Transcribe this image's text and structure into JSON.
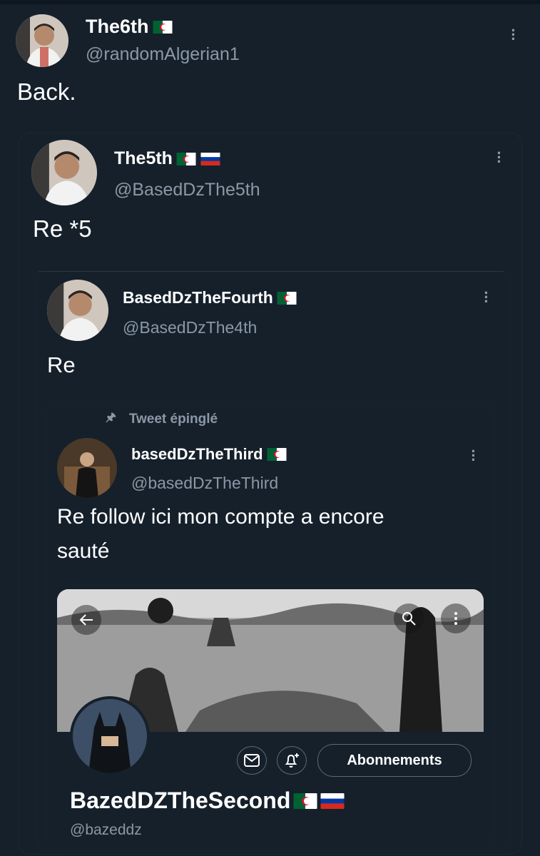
{
  "tweet1": {
    "name": "The6th",
    "handle": "@randomAlgerian1",
    "text": "Back.",
    "flags": [
      "algeria"
    ]
  },
  "tweet2": {
    "name": "The5th",
    "handle": "@BasedDzThe5th",
    "text": "Re *5",
    "flags": [
      "algeria",
      "russia"
    ]
  },
  "tweet3": {
    "name": "BasedDzTheFourth",
    "handle": "@BasedDzThe4th",
    "text": "Re",
    "flags": [
      "algeria"
    ]
  },
  "tweet4": {
    "pinned_label": "Tweet épinglé",
    "name": "basedDzTheThird",
    "handle": "@basedDzTheThird",
    "text_line1": "Re follow ici mon compte a encore",
    "text_line2": "sauté",
    "flags": [
      "algeria"
    ]
  },
  "profile": {
    "name": "BazedDZTheSecond",
    "handle": "@bazeddz",
    "follow_label": "Abonnements",
    "flags": [
      "algeria",
      "russia"
    ],
    "icons": [
      "back-arrow-icon",
      "search-icon",
      "more-icon",
      "envelope-icon",
      "bell-plus-icon"
    ]
  },
  "colors": {
    "background": "#15202b",
    "secondary_text": "#8b98a5",
    "border": "#2a3844"
  }
}
